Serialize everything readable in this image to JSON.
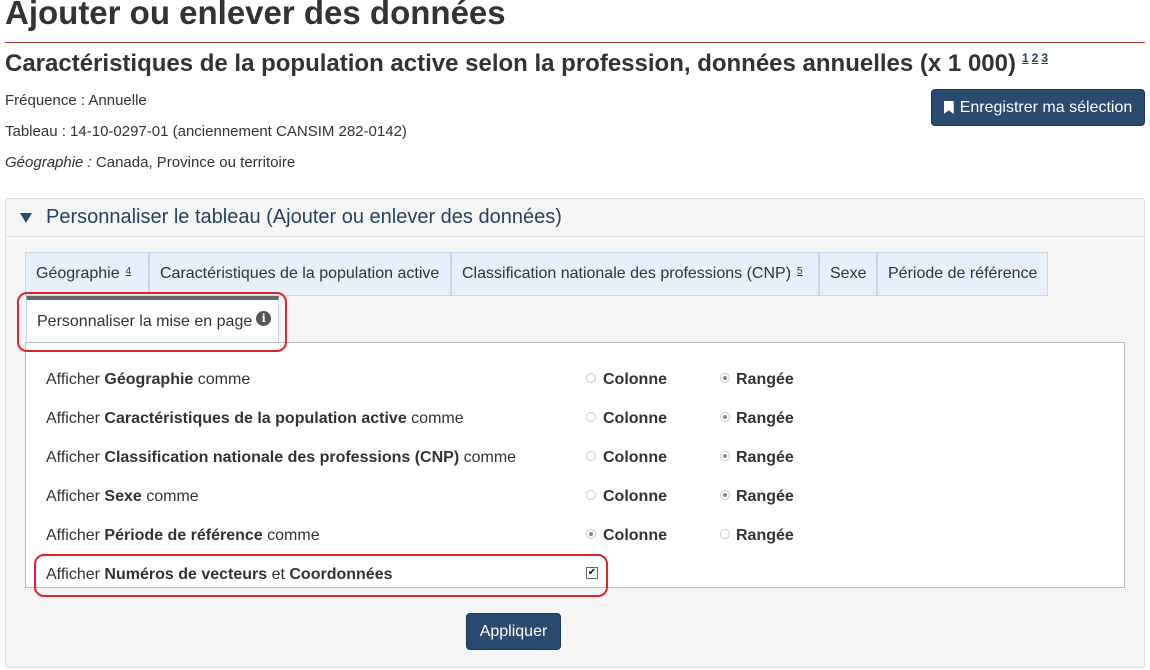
{
  "page": {
    "title": "Ajouter ou enlever des données",
    "subtitle": "Caractéristiques de la population active selon la profession, données annuelles (x 1 000)",
    "subtitle_refs": [
      "1",
      "2",
      "3"
    ]
  },
  "meta": {
    "frequency_label": "Fréquence : ",
    "frequency_value": "Annuelle",
    "table_label": "Tableau : ",
    "table_value": "14-10-0297-01 (anciennement CANSIM 282-0142)",
    "geography_label": "Géographie : ",
    "geography_value": "Canada, Province ou territoire"
  },
  "save_button": {
    "label": "Enregistrer ma sélection",
    "icon": "bookmark-icon"
  },
  "panel": {
    "summary": "Personnaliser le tableau (Ajouter ou enlever des données)"
  },
  "tabs": [
    {
      "label": "Géographie",
      "sup": "4"
    },
    {
      "label": "Caractéristiques de la population active",
      "sup": ""
    },
    {
      "label": "Classification nationale des professions (CNP)",
      "sup": "5"
    },
    {
      "label": "Sexe",
      "sup": ""
    },
    {
      "label": "Période de référence",
      "sup": ""
    },
    {
      "label": "Personnaliser la mise en page",
      "sup": "",
      "active": true,
      "icon": "info-icon"
    }
  ],
  "layout_rows": [
    {
      "prefix": "Afficher ",
      "dimension": "Géographie",
      "suffix": " comme",
      "selected": "Rangée"
    },
    {
      "prefix": "Afficher ",
      "dimension": "Caractéristiques de la population active",
      "suffix": " comme",
      "selected": "Rangée"
    },
    {
      "prefix": "Afficher ",
      "dimension": "Classification nationale des professions (CNP)",
      "suffix": " comme",
      "selected": "Rangée"
    },
    {
      "prefix": "Afficher ",
      "dimension": "Sexe",
      "suffix": " comme",
      "selected": "Rangée"
    },
    {
      "prefix": "Afficher ",
      "dimension": "Période de référence",
      "suffix": " comme",
      "selected": "Colonne"
    }
  ],
  "options": {
    "column": "Colonne",
    "row": "Rangée"
  },
  "vector_row": {
    "prefix": "Afficher ",
    "part1": "Numéros de vecteurs",
    "mid": " et ",
    "part2": "Coordonnées",
    "checked": true
  },
  "apply_button": {
    "label": "Appliquer"
  },
  "colors": {
    "primary": "#2b4a6f",
    "highlight": "#e0262c",
    "title_rule": "#a8322a"
  }
}
